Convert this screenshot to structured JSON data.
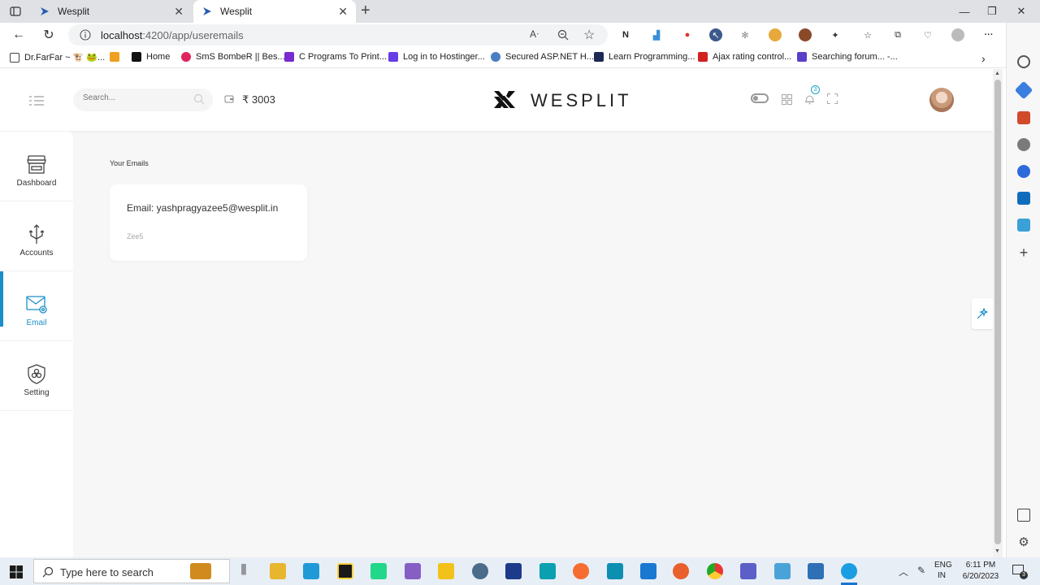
{
  "browser": {
    "tabs": [
      {
        "title": "Wesplit",
        "active": false
      },
      {
        "title": "Wesplit",
        "active": true
      }
    ],
    "url_host": "localhost",
    "url_rest": ":4200/app/useremails",
    "bookmarks": [
      "Dr.FarFar ~ 🐮 🐸...",
      "",
      "Home",
      "SmS BombeR || Bes...",
      "C Programs To Print...",
      "Log in to Hostinger...",
      "Secured ASP.NET H...",
      "Learn Programming...",
      "Ajax rating control...",
      "Searching forum... -..."
    ]
  },
  "app": {
    "search_placeholder": "Search...",
    "balance": "₹ 3003",
    "brand": "WESPLIT",
    "notification_count": "3",
    "sidebar": [
      {
        "label": "Dashboard",
        "icon": "store-icon",
        "active": false
      },
      {
        "label": "Accounts",
        "icon": "arrows-icon",
        "active": false
      },
      {
        "label": "Email",
        "icon": "email-icon",
        "active": true
      },
      {
        "label": "Setting",
        "icon": "shield-settings-icon",
        "active": false
      }
    ],
    "page_title": "Your Emails",
    "emails": [
      {
        "email": "Email: yashpragyazee5@wesplit.in",
        "service": "Zee5"
      }
    ],
    "accent_color": "#1a8fc7"
  },
  "taskbar": {
    "search_placeholder": "Type here to search",
    "lang_top": "ENG",
    "lang_bottom": "IN",
    "time": "6:11 PM",
    "date": "6/20/2023",
    "notifications": "3"
  }
}
